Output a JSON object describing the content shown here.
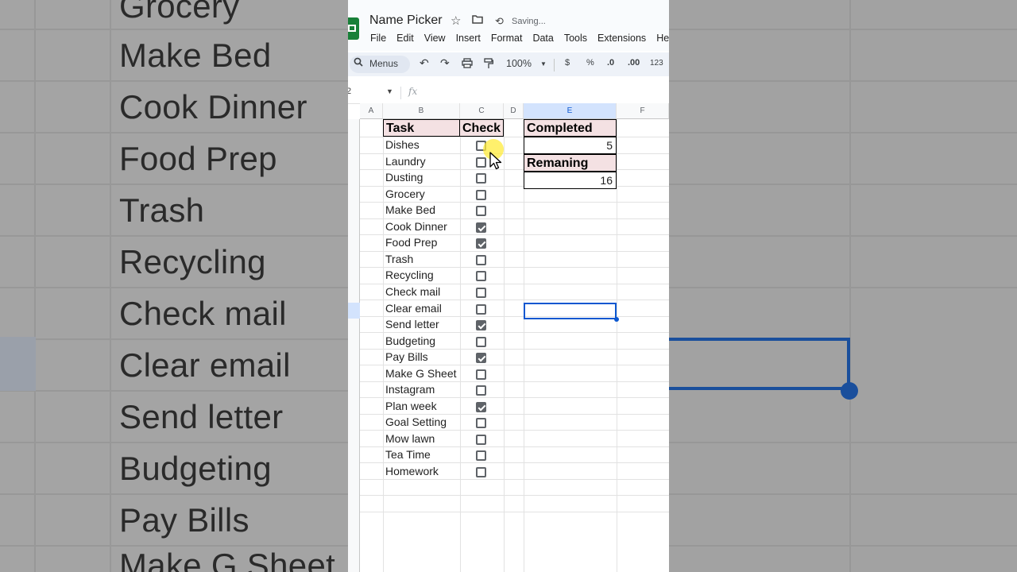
{
  "background": {
    "left_words": [
      "Grocery",
      "Make Bed",
      "Cook Dinner",
      "Food Prep",
      "Trash",
      "Recycling",
      "Check mail",
      "Clear email",
      "Send letter",
      "Budgeting",
      "Pay Bills",
      "Make G Sheet"
    ]
  },
  "titlebar": {
    "doc_title": "Name Picker",
    "status": "Saving...",
    "menu": [
      "File",
      "Edit",
      "View",
      "Insert",
      "Format",
      "Data",
      "Tools",
      "Extensions",
      "He"
    ]
  },
  "toolbar": {
    "search_label": "Menus",
    "zoom": "100%",
    "currency": "$",
    "percent": "%",
    "decimal_decrease": ".0",
    "decimal_increase": ".00",
    "number_format": "123"
  },
  "formula_bar": {
    "name_box": "2",
    "fx": "fx"
  },
  "columns": [
    "A",
    "B",
    "C",
    "D",
    "E",
    "F"
  ],
  "headers": {
    "task": "Task",
    "check": "Check",
    "completed": "Completed",
    "remaining": "Remaning"
  },
  "summary": {
    "completed_value": "5",
    "remaining_value": "16"
  },
  "tasks": [
    {
      "name": "Dishes",
      "checked": false
    },
    {
      "name": "Laundry",
      "checked": false
    },
    {
      "name": "Dusting",
      "checked": false
    },
    {
      "name": "Grocery",
      "checked": false
    },
    {
      "name": "Make Bed",
      "checked": false
    },
    {
      "name": "Cook Dinner",
      "checked": true
    },
    {
      "name": "Food Prep",
      "checked": true
    },
    {
      "name": "Trash",
      "checked": false
    },
    {
      "name": "Recycling",
      "checked": false
    },
    {
      "name": "Check mail",
      "checked": false
    },
    {
      "name": "Clear email",
      "checked": false
    },
    {
      "name": "Send letter",
      "checked": true
    },
    {
      "name": "Budgeting",
      "checked": false
    },
    {
      "name": "Pay Bills",
      "checked": true
    },
    {
      "name": "Make G Sheet",
      "checked": false
    },
    {
      "name": "Instagram",
      "checked": false
    },
    {
      "name": "Plan week",
      "checked": true
    },
    {
      "name": "Goal Setting",
      "checked": false
    },
    {
      "name": "Mow lawn",
      "checked": false
    },
    {
      "name": "Tea Time",
      "checked": false
    },
    {
      "name": "Homework",
      "checked": false
    }
  ],
  "colors": {
    "header_fill": "#f4e1e3",
    "selection": "#0b57d0",
    "sheets_green": "#188038"
  }
}
